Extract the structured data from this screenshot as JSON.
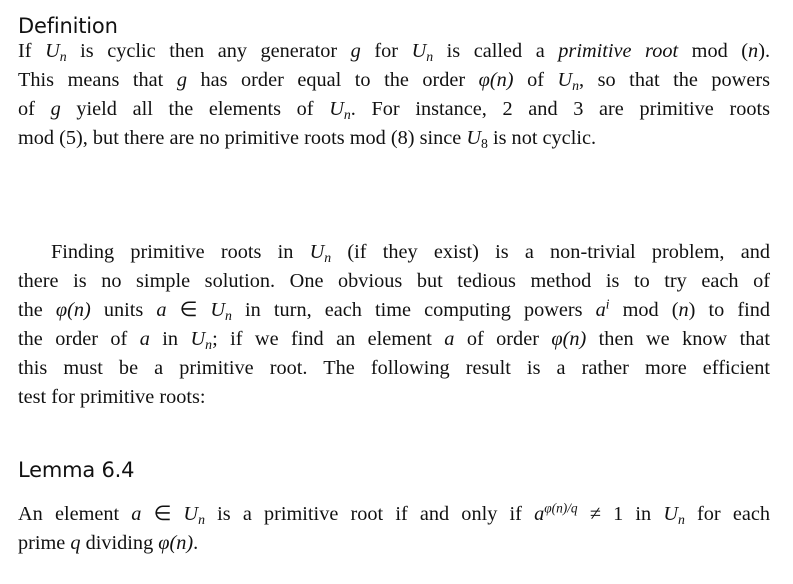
{
  "definition": {
    "heading": "Definition",
    "lines": [
      {
        "t1": "If ",
        "m1": "U",
        "s1": "n",
        "t2": " is cyclic then any generator ",
        "m2": "g",
        "t3": " for ",
        "m3": "U",
        "s3": "n",
        "t4": " is called a ",
        "em": "primitive root",
        "t5": " mod (",
        "m5": "n",
        "t6": ")."
      },
      {
        "t1": "This means that ",
        "m1": "g",
        "t2": " has order equal to the order ",
        "m2": "φ(n)",
        "t3": " of ",
        "m3": "U",
        "s3": "n",
        "t4": ", so that the powers"
      },
      {
        "t1": "of ",
        "m1": "g",
        "t2": " yield all the elements of ",
        "m2": "U",
        "s2": "n",
        "t3": ". For instance, 2 and 3 are primitive roots"
      },
      {
        "t1": "mod (5), but there are no primitive roots mod (8) since ",
        "m1": "U",
        "s1": "8",
        "t2": " is not cyclic."
      }
    ]
  },
  "discussion": {
    "lines": [
      {
        "t1": "Finding primitive roots in ",
        "m1": "U",
        "s1": "n",
        "t2": " (if they exist) is a non-trivial problem, and"
      },
      {
        "t1": "there is no simple solution. One obvious but tedious method is to try each of"
      },
      {
        "t1": "the ",
        "m1": "φ(n)",
        "t2": " units ",
        "m2": "a",
        "t3": " ∈ ",
        "m3": "U",
        "s3": "n",
        "t4": " in turn, each time computing powers ",
        "m4": "a",
        "p4": "i",
        "t5": " mod (",
        "m5": "n",
        "t6": ") to find"
      },
      {
        "t1": "the order of ",
        "m1": "a",
        "t2": " in ",
        "m2": "U",
        "s2": "n",
        "t3": "; if we find an element ",
        "m3": "a",
        "t4": " of order ",
        "m4": "φ(n)",
        "t5": " then we know that"
      },
      {
        "t1": "this must be a primitive root. The following result is a rather more efficient"
      },
      {
        "t1": "test for primitive roots:"
      }
    ]
  },
  "lemma": {
    "heading": "Lemma 6.4",
    "lines": [
      {
        "t1": "An element ",
        "m1": "a",
        "t2": " ∈ ",
        "m2": "U",
        "s2": "n",
        "t3": " is a primitive root if and only if ",
        "m3": "a",
        "p3": "φ(n)/q",
        "t4": " ≠ 1 in ",
        "m4": "U",
        "s4": "n",
        "t5": " for each"
      },
      {
        "t1": "prime ",
        "m1": "q",
        "t2": " dividing ",
        "m2": "φ(n)",
        "t3": "."
      }
    ]
  }
}
